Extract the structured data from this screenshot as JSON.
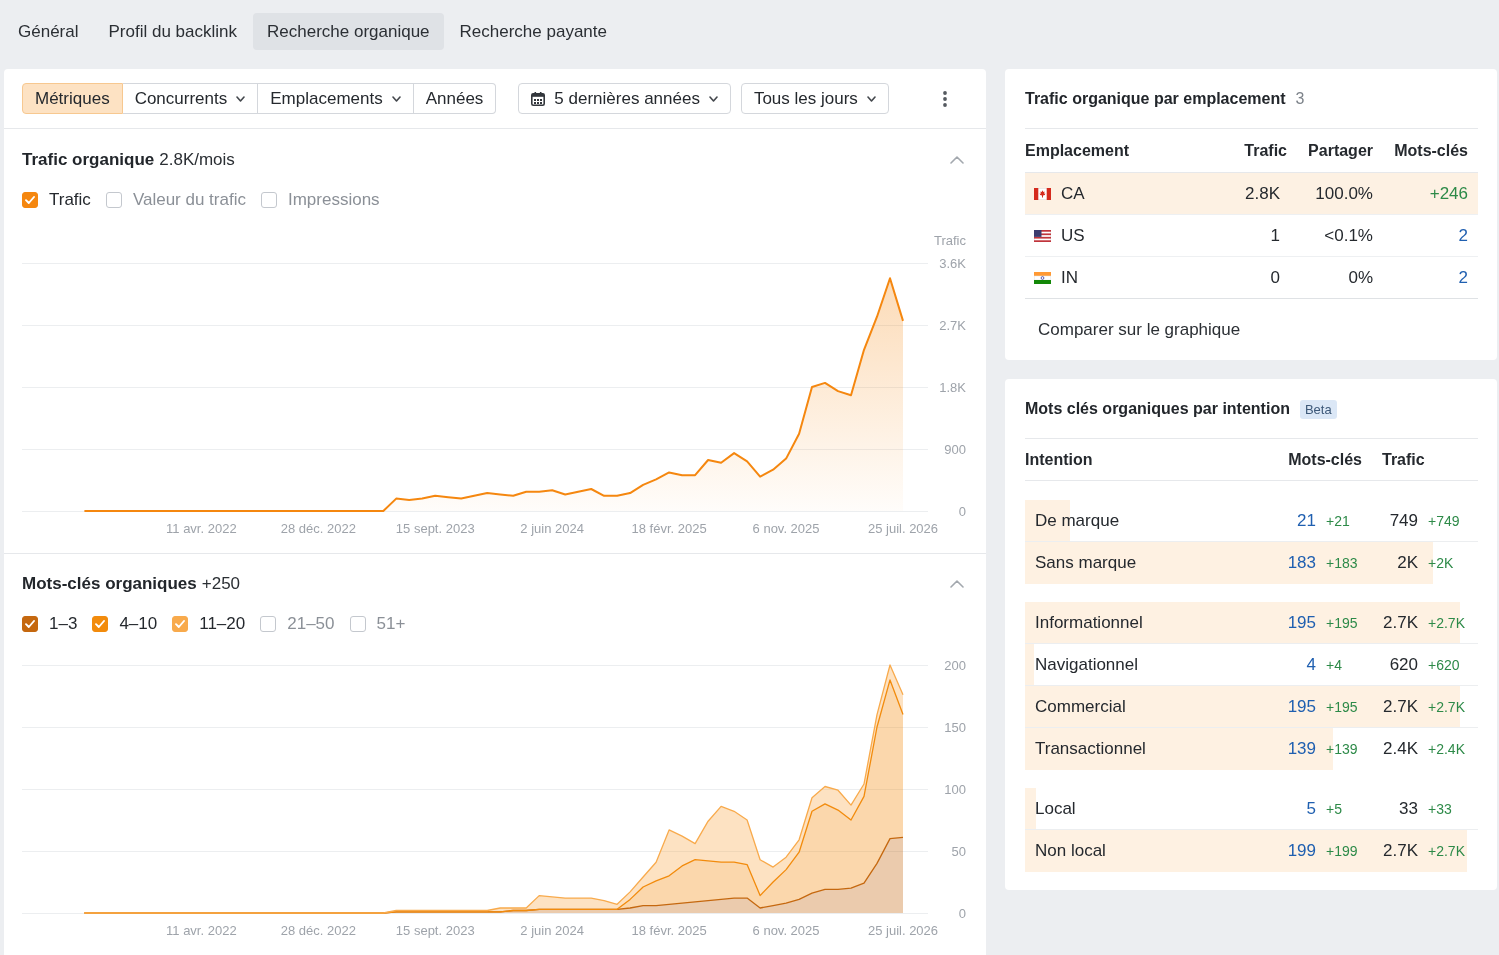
{
  "nav_tabs": [
    {
      "label": "Général",
      "selected": false
    },
    {
      "label": "Profil du backlink",
      "selected": false
    },
    {
      "label": "Recherche organique",
      "selected": true
    },
    {
      "label": "Recherche payante",
      "selected": false
    }
  ],
  "toolbar": {
    "segments": [
      {
        "label": "Métriques",
        "kind": "button",
        "selected": true
      },
      {
        "label": "Concurrents",
        "kind": "dropdown",
        "selected": false
      },
      {
        "label": "Emplacements",
        "kind": "dropdown",
        "selected": false
      },
      {
        "label": "Années",
        "kind": "button",
        "selected": false
      }
    ],
    "filters": [
      {
        "label": "5 dernières années",
        "kind": "daterange"
      },
      {
        "label": "Tous les jours",
        "kind": "dropdown"
      }
    ]
  },
  "sections": [
    {
      "title": "Trafic organique",
      "value": "2.8K/mois",
      "expanded": true,
      "legend": [
        {
          "label": "Trafic",
          "checked": true,
          "color": "#f5870f"
        },
        {
          "label": "Valeur du trafic",
          "checked": false
        },
        {
          "label": "Impressions",
          "checked": false
        }
      ],
      "chart_data": {
        "type": "area",
        "ylabel": "Trafic",
        "grid": true,
        "categories": [
          null,
          null,
          null,
          null,
          null,
          null,
          null,
          null,
          null,
          "11 avr. 2022",
          null,
          null,
          null,
          null,
          null,
          null,
          null,
          null,
          "28 déc. 2022",
          null,
          null,
          null,
          null,
          null,
          null,
          null,
          null,
          "15 sept. 2023",
          null,
          null,
          null,
          null,
          null,
          null,
          null,
          null,
          "2 juin 2024",
          null,
          null,
          null,
          null,
          null,
          null,
          null,
          null,
          "18 févr. 2025",
          null,
          null,
          null,
          null,
          null,
          null,
          null,
          null,
          "6 nov. 2025",
          null,
          null,
          null,
          null,
          null,
          null,
          null,
          null,
          "25 juil. 2026"
        ],
        "series": [
          {
            "color": "#f5870f",
            "values": [
              0,
              0,
              0,
              0,
              0,
              0,
              0,
              0,
              0,
              0,
              0,
              0,
              0,
              0,
              0,
              0,
              0,
              0,
              0,
              0,
              0,
              0,
              0,
              0,
              180,
              160,
              180,
              220,
              200,
              180,
              220,
              260,
              240,
              220,
              280,
              280,
              300,
              240,
              280,
              320,
              220,
              220,
              260,
              380,
              460,
              560,
              520,
              520,
              740,
              700,
              840,
              720,
              500,
              600,
              760,
              1120,
              1800,
              1860,
              1740,
              1680,
              2340,
              2820,
              3380,
              2760
            ]
          }
        ],
        "ylim": [
          0,
          3600
        ],
        "yticks": [
          {
            "value": 0,
            "label": "0"
          },
          {
            "value": 900,
            "label": "900"
          },
          {
            "value": 1800,
            "label": "1.8K"
          },
          {
            "value": 2700,
            "label": "2.7K"
          },
          {
            "value": 3600,
            "label": "3.6K"
          }
        ]
      }
    },
    {
      "title": "Mots-clés organiques",
      "value": "+250",
      "expanded": true,
      "legend": [
        {
          "label": "1–3",
          "checked": true,
          "color": "#c5680f"
        },
        {
          "label": "4–10",
          "checked": true,
          "color": "#f28b0c"
        },
        {
          "label": "11–20",
          "checked": true,
          "color": "#f8aa4c"
        },
        {
          "label": "21–50",
          "checked": false
        },
        {
          "label": "51+",
          "checked": false
        }
      ],
      "chart_data": {
        "type": "area",
        "stacked": true,
        "grid": true,
        "categories": [
          null,
          null,
          null,
          null,
          null,
          null,
          null,
          null,
          null,
          "11 avr. 2022",
          null,
          null,
          null,
          null,
          null,
          null,
          null,
          null,
          "28 déc. 2022",
          null,
          null,
          null,
          null,
          null,
          null,
          null,
          null,
          "15 sept. 2023",
          null,
          null,
          null,
          null,
          null,
          null,
          null,
          null,
          "2 juin 2024",
          null,
          null,
          null,
          null,
          null,
          null,
          null,
          null,
          "18 févr. 2025",
          null,
          null,
          null,
          null,
          null,
          null,
          null,
          null,
          "6 nov. 2025",
          null,
          null,
          null,
          null,
          null,
          null,
          null,
          null,
          "25 juil. 2026"
        ],
        "series": [
          {
            "color": "#c5680f",
            "values": [
              0,
              0,
              0,
              0,
              0,
              0,
              0,
              0,
              0,
              0,
              0,
              0,
              0,
              0,
              0,
              0,
              0,
              0,
              0,
              0,
              0,
              0,
              0,
              0,
              1,
              1,
              1,
              1,
              1,
              1,
              1,
              1,
              1,
              2,
              2,
              3,
              3,
              3,
              3,
              3,
              3,
              3,
              4,
              6,
              6,
              7,
              8,
              9,
              10,
              11,
              12,
              12,
              4,
              6,
              8,
              11,
              16,
              19,
              19,
              20,
              24,
              40,
              60,
              61
            ]
          },
          {
            "color": "#f28b0c",
            "values": [
              0,
              0,
              0,
              0,
              0,
              0,
              0,
              0,
              0,
              0,
              0,
              0,
              0,
              0,
              0,
              0,
              0,
              0,
              0,
              0,
              0,
              0,
              0,
              0,
              0,
              0,
              0,
              0,
              0,
              0,
              0,
              0,
              0,
              0,
              0,
              0,
              0,
              0,
              0,
              0,
              0,
              0,
              7,
              15,
              20,
              23,
              30,
              34,
              32,
              30,
              29,
              27,
              10,
              19,
              27,
              38,
              66,
              69,
              64,
              55,
              70,
              110,
              128,
              99
            ]
          },
          {
            "color": "#f8aa4c",
            "values": [
              0,
              0,
              0,
              0,
              0,
              0,
              0,
              0,
              0,
              0,
              0,
              0,
              0,
              0,
              0,
              0,
              0,
              0,
              0,
              0,
              0,
              0,
              0,
              0,
              1,
              1,
              1,
              1,
              1,
              1,
              1,
              1,
              3,
              2,
              2,
              11,
              10,
              9,
              9,
              9,
              7,
              4,
              6,
              8,
              15,
              37,
              24,
              13,
              32,
              45,
              41,
              36,
              29,
              12,
              10,
              10,
              11,
              14,
              16,
              12,
              10,
              10,
              12,
              16
            ]
          }
        ],
        "ylim": [
          0,
          200
        ],
        "yticks": [
          0,
          50,
          100,
          150,
          200
        ]
      }
    }
  ],
  "location_panel": {
    "title": "Trafic organique par emplacement",
    "count": "3",
    "columns": [
      "Emplacement",
      "Trafic",
      "Partager",
      "Mots-clés"
    ],
    "rows": [
      {
        "kind": "change",
        "location": "CA",
        "traffic": "2.8K",
        "share": "100.0%",
        "keywords": "+246",
        "selected": true
      },
      {
        "kind": "count",
        "location": "US",
        "traffic": "1",
        "share": "<0.1%",
        "keywords": "2",
        "selected": false
      },
      {
        "kind": "count",
        "location": "IN",
        "traffic": "0",
        "share": "0%",
        "keywords": "2",
        "selected": false
      }
    ],
    "compare_button": "Comparer sur le graphique"
  },
  "intent_panel": {
    "title": "Mots clés organiques par intention",
    "badge": "Beta",
    "columns": [
      "Intention",
      "Mots-clés",
      "Trafic"
    ],
    "groups": [
      {
        "rows": [
          {
            "intent": "De marque",
            "keywords": "21",
            "keywords_change": "+21",
            "traffic": "749",
            "traffic_change": "+749",
            "level": 0.1
          },
          {
            "intent": "Sans marque",
            "keywords": "183",
            "keywords_change": "+183",
            "traffic": "2K",
            "traffic_change": "+2K",
            "level": 0.9
          }
        ]
      },
      {
        "rows": [
          {
            "intent": "Informationnel",
            "keywords": "195",
            "keywords_change": "+195",
            "traffic": "2.7K",
            "traffic_change": "+2.7K",
            "level": 0.96
          },
          {
            "intent": "Navigationnel",
            "keywords": "4",
            "keywords_change": "+4",
            "traffic": "620",
            "traffic_change": "+620",
            "level": 0.02
          },
          {
            "intent": "Commercial",
            "keywords": "195",
            "keywords_change": "+195",
            "traffic": "2.7K",
            "traffic_change": "+2.7K",
            "level": 0.96
          },
          {
            "intent": "Transactionnel",
            "keywords": "139",
            "keywords_change": "+139",
            "traffic": "2.4K",
            "traffic_change": "+2.4K",
            "level": 0.68
          }
        ]
      },
      {
        "rows": [
          {
            "intent": "Local",
            "keywords": "5",
            "keywords_change": "+5",
            "traffic": "33",
            "traffic_change": "+33",
            "level": 0.025
          },
          {
            "intent": "Non local",
            "keywords": "199",
            "keywords_change": "+199",
            "traffic": "2.7K",
            "traffic_change": "+2.7K",
            "level": 0.975
          }
        ]
      }
    ]
  }
}
